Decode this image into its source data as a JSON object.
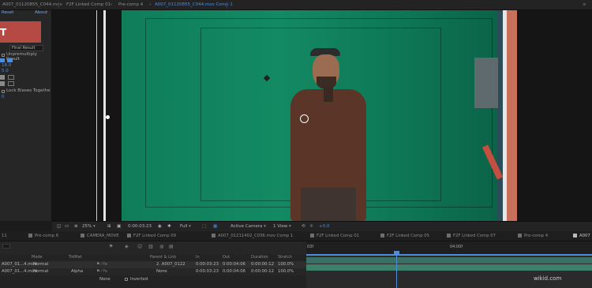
{
  "tabs": {
    "source": "A007_01120855_C044.mov",
    "items": [
      "F2F Linked Comp 01",
      "Pre-comp 4",
      "A007_01120855_C044.mov Comp 1"
    ],
    "active_index": 2
  },
  "effects": {
    "reset": "Reset",
    "about": "About",
    "source": "Final Result",
    "unmultiply": "Unpremultiply Result",
    "v1": "18.0",
    "v2": "5.0",
    "v3": "0",
    "lock": "Lock Biases Togethe"
  },
  "viewer_toolbar": {
    "zoom": "25%",
    "timecode": "0:00:03:23",
    "resolution": "Full",
    "camera": "Active Camera",
    "views": "1 View",
    "offset": "+0.0"
  },
  "timeline_tabs": [
    "Pre-comp 6",
    "CAMERA_MOVE",
    "F2F Linked Comp 09",
    "A007_01211402_C036.mov Comp 1",
    "F2F Linked Comp 01",
    "F2F Linked Comp 05",
    "F2F Linked Comp 07",
    "Pre-comp 4",
    "A007"
  ],
  "layer_headers": {
    "mode": "Mode",
    "trk": "TrkMat",
    "parent": "Parent & Link",
    "in": "In",
    "out": "Out",
    "duration": "Duration",
    "stretch": "Stretch"
  },
  "layers": [
    {
      "name": "A007_01...4.mov",
      "mode": "Normal",
      "trk": "",
      "parent": "2. A007_0122",
      "in": "0:00:03:23",
      "out": "0:00:04:06",
      "duration": "0:00:00:12",
      "stretch": "100.0%"
    },
    {
      "name": "A007_01...4.mov",
      "mode": "Normal",
      "trk": "Alpha",
      "parent": "None",
      "in": "0:00:03:23",
      "out": "0:00:04:06",
      "duration": "0:00:00:12",
      "stretch": "100.0%"
    }
  ],
  "sub_row": {
    "parent": "None",
    "inverted": "Inverted"
  },
  "ruler": {
    "start": "03f",
    "mark": "04:00f"
  },
  "colors": {
    "accent": "#4f8cdb",
    "green_screen": "#138a63",
    "panel": "#232323",
    "track_bar": "#3c7f6a"
  },
  "watermark": "wikid.com"
}
